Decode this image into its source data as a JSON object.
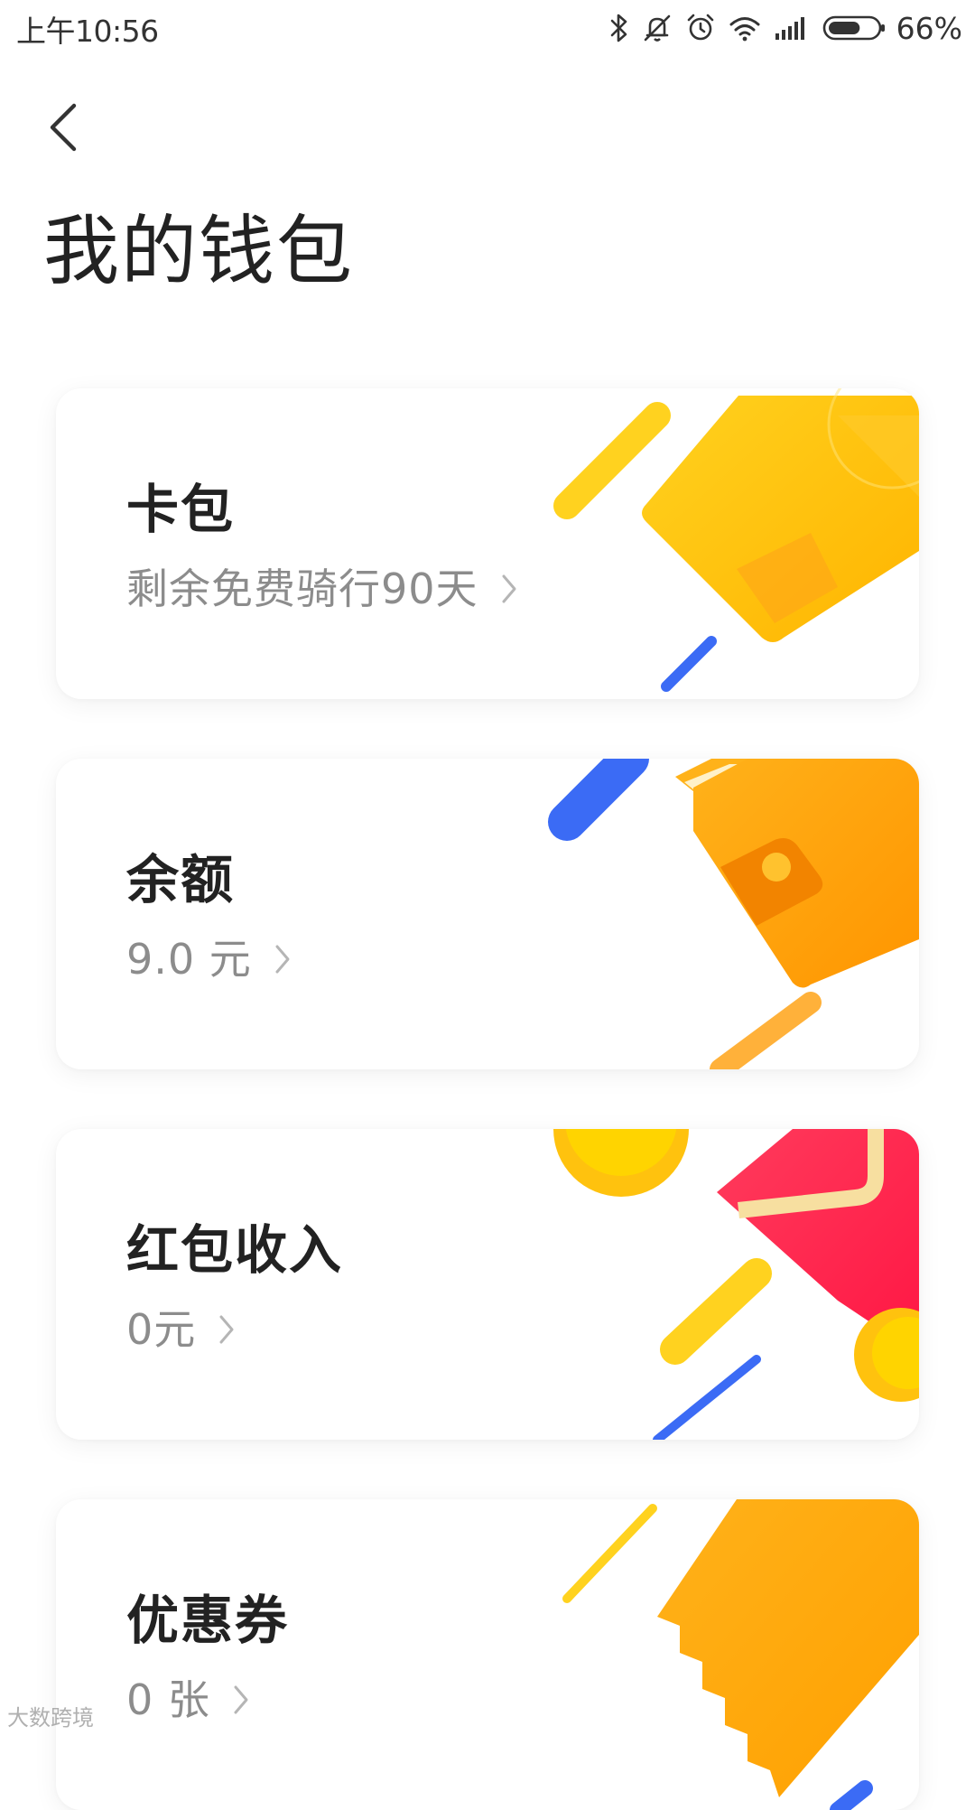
{
  "status_bar": {
    "time": "上午10:56",
    "battery_percent": "66%",
    "battery_level": 0.66,
    "icons": [
      "bluetooth-icon",
      "mute-icon",
      "alarm-icon",
      "wifi-icon",
      "signal-icon",
      "battery-icon"
    ]
  },
  "header": {
    "back_icon": "chevron-left-icon",
    "title": "我的钱包"
  },
  "cards": [
    {
      "title": "卡包",
      "subtitle": "剩余免费骑行90天",
      "art": "card-wallet-illustration"
    },
    {
      "title": "余额",
      "subtitle": "9.0 元",
      "art": "wallet-illustration"
    },
    {
      "title": "红包收入",
      "subtitle": "0元",
      "art": "red-envelope-illustration"
    },
    {
      "title": "优惠券",
      "subtitle": "0 张",
      "art": "coupon-illustration"
    }
  ],
  "colors": {
    "yellow": "#FFD21F",
    "orange": "#FFA31A",
    "blue": "#3B6BF5",
    "red": "#FF2D55",
    "subtitle_gray": "#8C8C8C"
  },
  "watermark": "大数跨境"
}
